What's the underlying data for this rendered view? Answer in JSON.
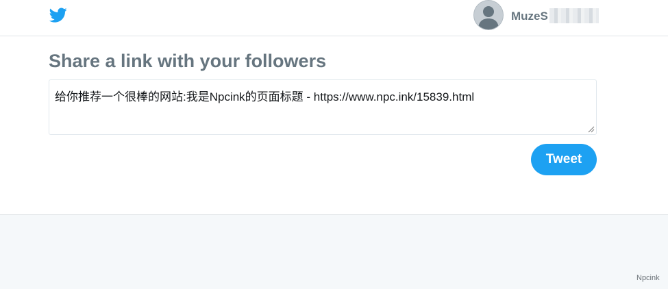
{
  "header": {
    "logo_icon": "twitter-bird-icon",
    "avatar_icon": "default-avatar-icon",
    "username": "MuzeS",
    "brand_color": "#1da1f2"
  },
  "share": {
    "title": "Share a link with your followers",
    "compose_text": "给你推荐一个很棒的网站:我是Npcink的页面标题 - https://www.npc.ink/15839.html",
    "tweet_label": "Tweet"
  },
  "footer": {
    "watermark": "Npcink"
  }
}
